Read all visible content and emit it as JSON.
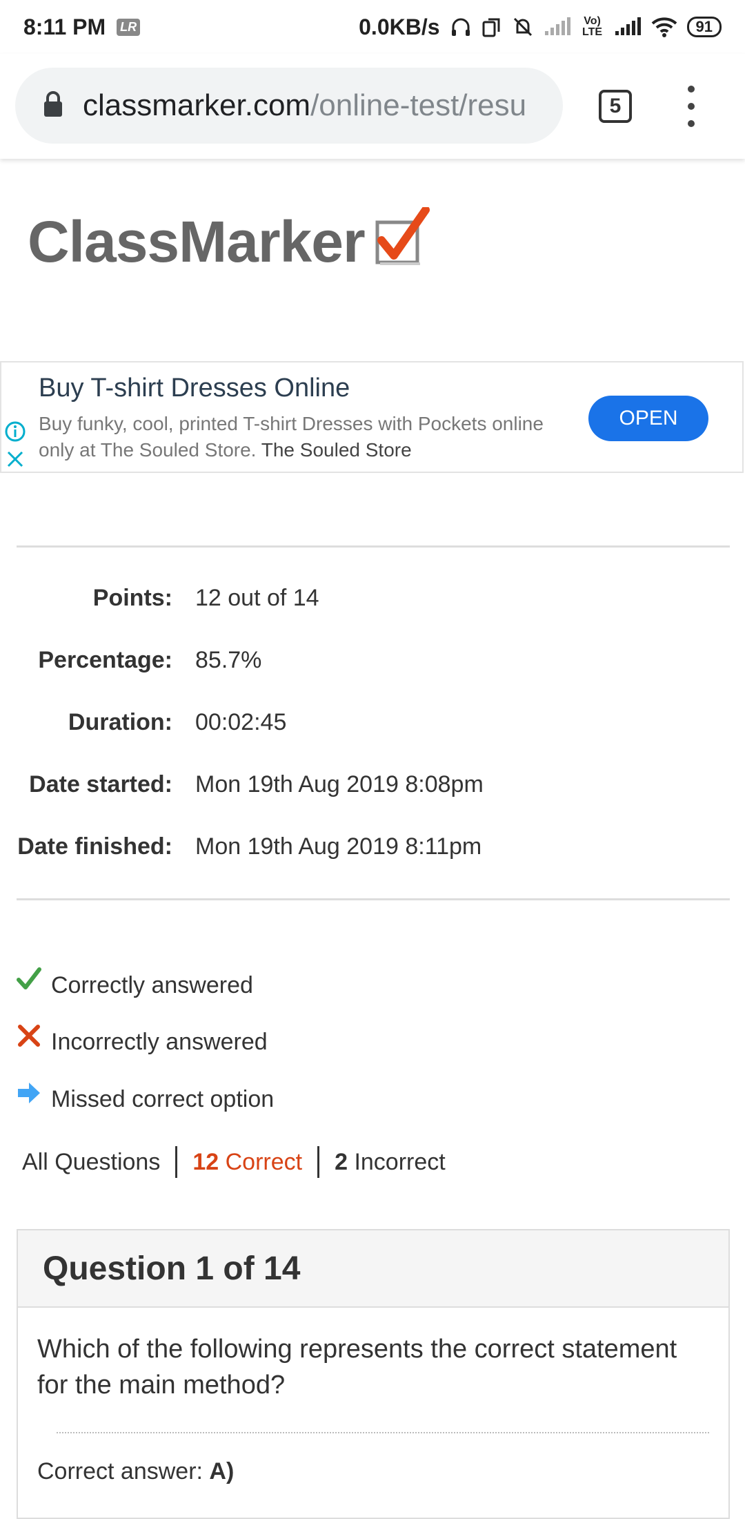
{
  "status_bar": {
    "time": "8:11 PM",
    "app_badge": "LR",
    "net_speed": "0.0KB/s",
    "volte": "Vo) LTE",
    "battery": "91"
  },
  "browser": {
    "url_domain": "classmarker.com",
    "url_path": "/online-test/resu",
    "tab_count": "5"
  },
  "site": {
    "logo_text": "ClassMarker"
  },
  "ad": {
    "title": "Buy T-shirt Dresses Online",
    "description": "Buy funky, cool, printed T-shirt Dresses with Pockets online only at The Souled Store.",
    "brand": "The Souled Store",
    "cta": "OPEN"
  },
  "results": [
    {
      "label": "Points:",
      "value": "12 out of 14"
    },
    {
      "label": "Percentage:",
      "value": "85.7%"
    },
    {
      "label": "Duration:",
      "value": "00:02:45"
    },
    {
      "label": "Date started:",
      "value": "Mon 19th Aug 2019 8:08pm"
    },
    {
      "label": "Date finished:",
      "value": "Mon 19th Aug 2019 8:11pm"
    }
  ],
  "legend": {
    "correct": "Correctly answered",
    "incorrect": "Incorrectly answered",
    "missed": "Missed correct option"
  },
  "filters": {
    "all": "All Questions",
    "correct_count": "12",
    "correct_label": "Correct",
    "incorrect_count": "2",
    "incorrect_label": "Incorrect"
  },
  "question": {
    "header": "Question 1 of 14",
    "text": "Which of the following represents the correct statement for the main method?",
    "answer_label": "Correct answer:",
    "answer_value": "A)"
  },
  "colors": {
    "accent_blue": "#1a73e8",
    "correct_green": "#43a047",
    "incorrect_red": "#d84315",
    "missed_blue": "#42a5f5"
  }
}
